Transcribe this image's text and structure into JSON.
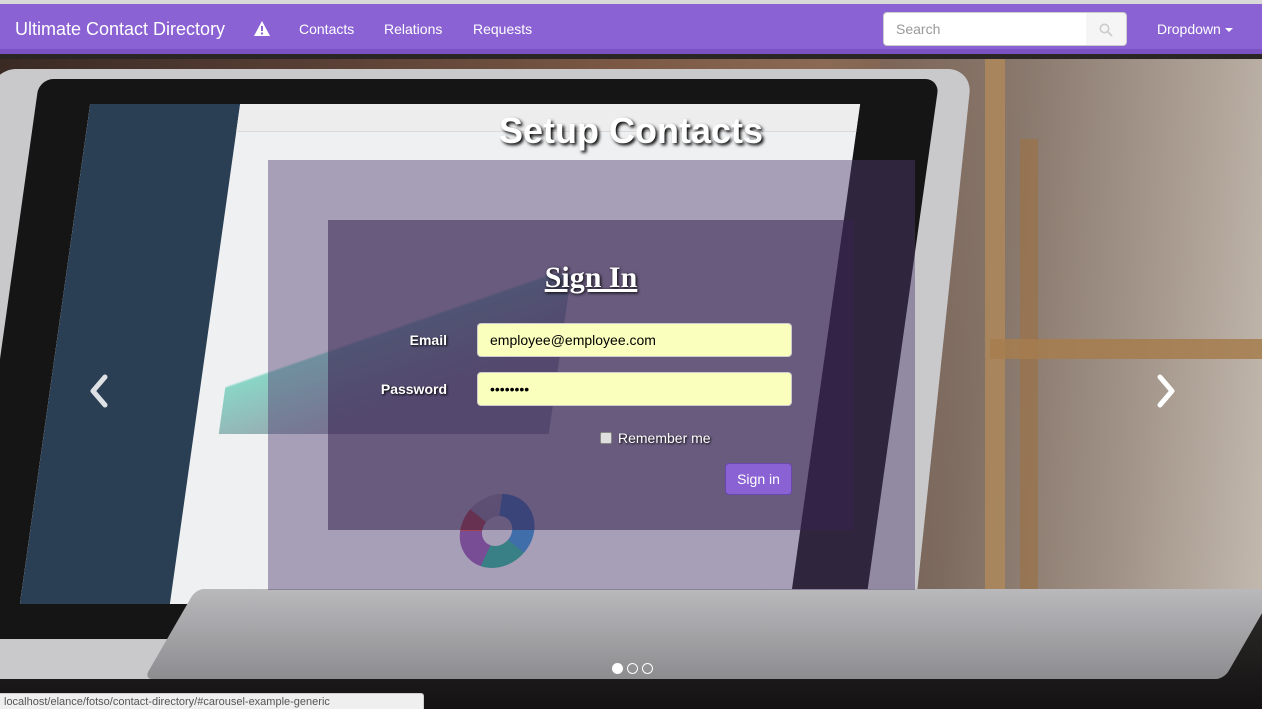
{
  "navbar": {
    "brand": "Ultimate Contact Directory",
    "warning_icon": "warning-triangle-icon",
    "links": [
      "Contacts",
      "Relations",
      "Requests"
    ],
    "search": {
      "placeholder": "Search",
      "icon": "search-icon"
    },
    "dropdown_label": "Dropdown"
  },
  "hero": {
    "title": "Setup Contacts"
  },
  "signin": {
    "heading": "Sign In",
    "email_label": "Email",
    "email_value": "employee@employee.com",
    "password_label": "Password",
    "password_value": "••••••••",
    "remember_label": "Remember me",
    "remember_checked": false,
    "submit_label": "Sign in"
  },
  "carousel": {
    "prev_icon": "chevron-left-icon",
    "next_icon": "chevron-right-icon",
    "indicator_count": 3,
    "active_index": 0
  },
  "statusbar": {
    "url": "localhost/elance/fotso/contact-directory/#carousel-example-generic"
  },
  "colors": {
    "navbar": "#8a62d3",
    "autofill": "#faffbd",
    "button": "#8a62d3"
  }
}
